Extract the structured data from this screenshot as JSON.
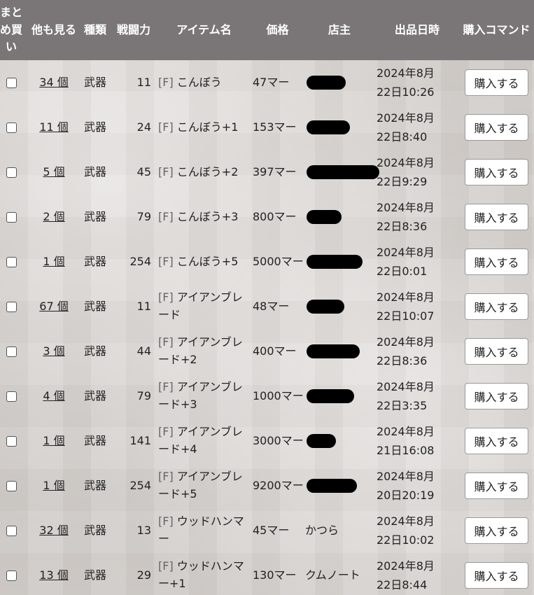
{
  "headers": {
    "bulk": "まとめ買い",
    "more": "他も見る",
    "type": "種類",
    "power": "戦闘力",
    "item": "アイテム名",
    "price": "価格",
    "seller": "店主",
    "listed": "出品日時",
    "command": "購入コマンド"
  },
  "buy_label": "購入する",
  "rows": [
    {
      "more": "34 個",
      "type": "武器",
      "power": "11",
      "tag": "[F]",
      "name": "こんぼう",
      "price": "47マー",
      "seller": "",
      "date1": "2024年8月",
      "date2": "22日10:26"
    },
    {
      "more": "11 個",
      "type": "武器",
      "power": "24",
      "tag": "[F]",
      "name": "こんぼう+1",
      "price": "153マー",
      "seller": "",
      "date1": "2024年8月",
      "date2": "22日8:40"
    },
    {
      "more": "5 個",
      "type": "武器",
      "power": "45",
      "tag": "[F]",
      "name": "こんぼう+2",
      "price": "397マー",
      "seller": "",
      "date1": "2024年8月",
      "date2": "22日9:29"
    },
    {
      "more": "2 個",
      "type": "武器",
      "power": "79",
      "tag": "[F]",
      "name": "こんぼう+3",
      "price": "800マー",
      "seller": "",
      "date1": "2024年8月",
      "date2": "22日8:36"
    },
    {
      "more": "1 個",
      "type": "武器",
      "power": "254",
      "tag": "[F]",
      "name": "こんぼう+5",
      "price": "5000マー",
      "seller": "",
      "date1": "2024年8月",
      "date2": "22日0:01"
    },
    {
      "more": "67 個",
      "type": "武器",
      "power": "11",
      "tag": "[F]",
      "name": "アイアンブレード",
      "price": "48マー",
      "seller": "",
      "date1": "2024年8月",
      "date2": "22日10:07"
    },
    {
      "more": "3 個",
      "type": "武器",
      "power": "44",
      "tag": "[F]",
      "name": "アイアンブレード+2",
      "price": "400マー",
      "seller": "",
      "date1": "2024年8月",
      "date2": "22日8:36"
    },
    {
      "more": "4 個",
      "type": "武器",
      "power": "79",
      "tag": "[F]",
      "name": "アイアンブレード+3",
      "price": "1000マー",
      "seller": "",
      "date1": "2024年8月",
      "date2": "22日3:35"
    },
    {
      "more": "1 個",
      "type": "武器",
      "power": "141",
      "tag": "[F]",
      "name": "アイアンブレード+4",
      "price": "3000マー",
      "seller": "",
      "date1": "2024年8月",
      "date2": "21日16:08"
    },
    {
      "more": "1 個",
      "type": "武器",
      "power": "254",
      "tag": "[F]",
      "name": "アイアンブレード+5",
      "price": "9200マー",
      "seller": "",
      "date1": "2024年8月",
      "date2": "20日20:19"
    },
    {
      "more": "32 個",
      "type": "武器",
      "power": "13",
      "tag": "[F]",
      "name": "ウッドハンマー",
      "price": "45マー",
      "seller": "かつら",
      "date1": "2024年8月",
      "date2": "22日10:02"
    },
    {
      "more": "13 個",
      "type": "武器",
      "power": "29",
      "tag": "[F]",
      "name": "ウッドハンマー+1",
      "price": "130マー",
      "seller": "クムノート",
      "date1": "2024年8月",
      "date2": "22日8:44"
    }
  ]
}
